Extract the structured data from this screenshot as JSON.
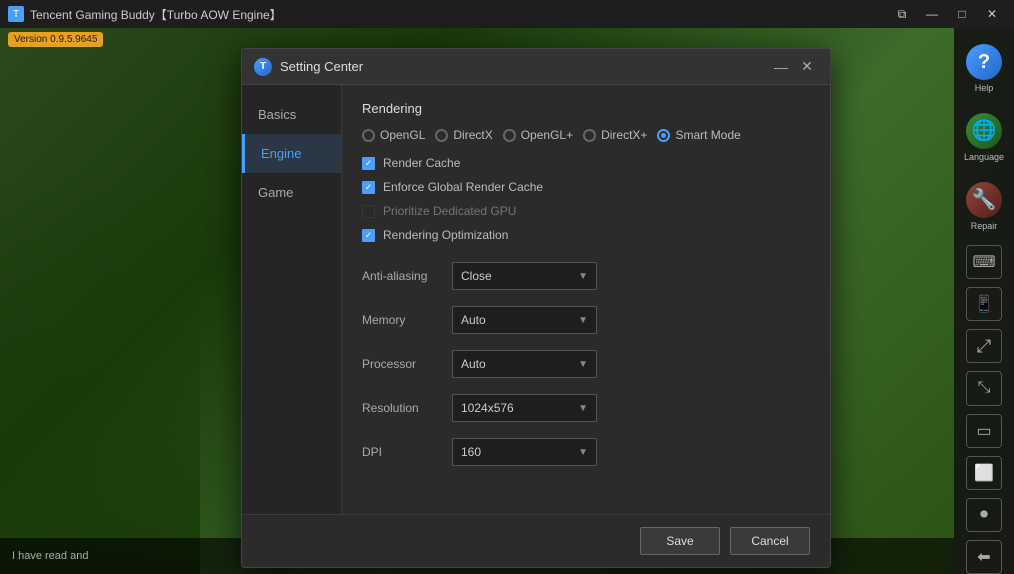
{
  "app": {
    "title": "Tencent Gaming Buddy【Turbo AOW Engine】",
    "version": "Version 0.9.5.9645"
  },
  "titlebar": {
    "restore_label": "⧉",
    "minimize_label": "—",
    "maximize_label": "□",
    "close_label": "✕"
  },
  "dialog": {
    "title": "Setting Center",
    "minimize_label": "—",
    "close_label": "✕"
  },
  "nav": {
    "items": [
      {
        "id": "basics",
        "label": "Basics"
      },
      {
        "id": "engine",
        "label": "Engine"
      },
      {
        "id": "game",
        "label": "Game"
      }
    ],
    "active": "engine"
  },
  "engine": {
    "rendering_section": "Rendering",
    "render_modes": [
      {
        "id": "opengl",
        "label": "OpenGL",
        "checked": false
      },
      {
        "id": "directx",
        "label": "DirectX",
        "checked": false
      },
      {
        "id": "openglplus",
        "label": "OpenGL+",
        "checked": false
      },
      {
        "id": "directxplus",
        "label": "DirectX+",
        "checked": false
      },
      {
        "id": "smartmode",
        "label": "Smart Mode",
        "checked": true
      }
    ],
    "checkboxes": [
      {
        "id": "render_cache",
        "label": "Render Cache",
        "checked": true,
        "disabled": false
      },
      {
        "id": "enforce_global_render_cache",
        "label": "Enforce Global Render Cache",
        "checked": true,
        "disabled": false
      },
      {
        "id": "prioritize_dedicated_gpu",
        "label": "Prioritize Dedicated GPU",
        "checked": false,
        "disabled": true
      },
      {
        "id": "rendering_optimization",
        "label": "Rendering Optimization",
        "checked": true,
        "disabled": false
      }
    ],
    "form_fields": [
      {
        "id": "anti_aliasing",
        "label": "Anti-aliasing",
        "value": "Close"
      },
      {
        "id": "memory",
        "label": "Memory",
        "value": "Auto"
      },
      {
        "id": "processor",
        "label": "Processor",
        "value": "Auto"
      },
      {
        "id": "resolution",
        "label": "Resolution",
        "value": "1024x576"
      },
      {
        "id": "dpi",
        "label": "DPI",
        "value": "160"
      }
    ]
  },
  "footer": {
    "save_label": "Save",
    "cancel_label": "Cancel"
  },
  "bottom_bar": {
    "text": "I have read and"
  },
  "right_sidebar": {
    "items": [
      {
        "id": "help",
        "icon": "?",
        "label": "Help"
      },
      {
        "id": "language",
        "icon": "🌐",
        "label": "Language"
      },
      {
        "id": "repair",
        "icon": "🔧",
        "label": "Repair"
      }
    ],
    "icon_buttons": [
      {
        "id": "keyboard",
        "icon": "⌨"
      },
      {
        "id": "phone",
        "icon": "📱"
      },
      {
        "id": "rotate",
        "icon": "⟳"
      },
      {
        "id": "resize",
        "icon": "⤡"
      },
      {
        "id": "screen",
        "icon": "▭"
      },
      {
        "id": "aspect",
        "icon": "⬜"
      },
      {
        "id": "record",
        "icon": "⏺"
      },
      {
        "id": "exit",
        "icon": "⬅"
      }
    ]
  }
}
